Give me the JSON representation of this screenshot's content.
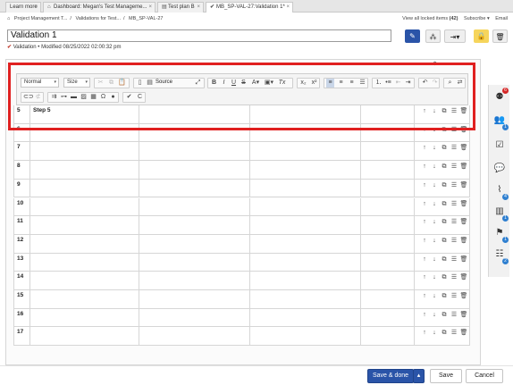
{
  "tabs": [
    {
      "label": "Learn more",
      "icon": ""
    },
    {
      "label": "Dashboard: Megan's Test Manageme...",
      "icon": "home-icon"
    },
    {
      "label": "Test plan B",
      "icon": "document-icon"
    },
    {
      "label": "MB_SP-VAL-27:Validation 1*",
      "icon": "checkmark-icon"
    }
  ],
  "breadcrumb": [
    "Project Management T...",
    "Validations for Test...",
    "MB_SP-VAL-27"
  ],
  "header_links": {
    "locked": "View all locked items",
    "locked_count": "(42)",
    "subscribe": "Subscribe ▾",
    "email": "Email"
  },
  "item": {
    "title": "Validation 1",
    "type": "Validation",
    "modified": "Modified 08/25/2022 02:00:32 pm"
  },
  "toolbar": {
    "format_combo": "Normal",
    "size_combo": "Size",
    "source_label": "Source"
  },
  "rows": [
    {
      "num": "5",
      "step": "Step 5"
    },
    {
      "num": "6",
      "step": ""
    },
    {
      "num": "7",
      "step": ""
    },
    {
      "num": "8",
      "step": ""
    },
    {
      "num": "9",
      "step": ""
    },
    {
      "num": "10",
      "step": ""
    },
    {
      "num": "11",
      "step": ""
    },
    {
      "num": "12",
      "step": ""
    },
    {
      "num": "13",
      "step": ""
    },
    {
      "num": "14",
      "step": ""
    },
    {
      "num": "15",
      "step": ""
    },
    {
      "num": "16",
      "step": ""
    },
    {
      "num": "17",
      "step": ""
    }
  ],
  "side_badges": {
    "top": "6",
    "people": "1",
    "pulse": "4",
    "history": "1",
    "flag": "1",
    "list": "2"
  },
  "footer": {
    "save_done": "Save & done",
    "save": "Save",
    "cancel": "Cancel"
  },
  "colors": {
    "accent": "#2a54a8",
    "highlight": "#e02020",
    "checkmark": "#c0392b"
  }
}
